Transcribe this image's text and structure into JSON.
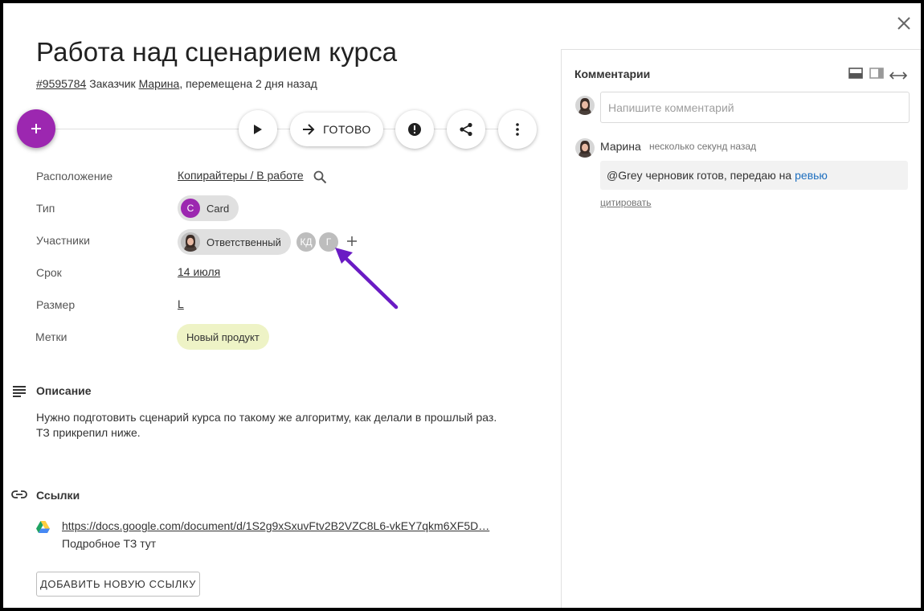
{
  "task": {
    "title": "Работа над сценарием курса",
    "id": "#9595784",
    "customer_prefix": "Заказчик",
    "customer": "Марина",
    "moved": ", перемещена 2 дня назад"
  },
  "toolbar": {
    "add_label": "+",
    "done_label": "ГОТОВО"
  },
  "properties": {
    "location": {
      "label": "Расположение",
      "value": "Копирайтеры / В работе"
    },
    "type": {
      "label": "Тип",
      "avatar_letter": "C",
      "value": "Card"
    },
    "members": {
      "label": "Участники",
      "responsible": "Ответственный",
      "member1": "КД",
      "member2": "Г"
    },
    "deadline": {
      "label": "Срок",
      "value": "14 июля"
    },
    "size": {
      "label": "Размер",
      "value": "L"
    },
    "tags": {
      "label": "Метки",
      "value": "Новый продукт"
    }
  },
  "description": {
    "title": "Описание",
    "line1": "Нужно подготовить сценарий курса по такому же алгоритму, как делали в прошлый раз.",
    "line2": "ТЗ прикрепил ниже."
  },
  "links": {
    "title": "Ссылки",
    "url": "https://docs.google.com/document/d/1S2g9xSxuvFtv2B2VZC8L6-vkEY7qkm6XF5D…",
    "caption": "Подробное ТЗ тут",
    "add_button": "ДОБАВИТЬ НОВУЮ ССЫЛКУ"
  },
  "comments": {
    "title": "Комментарии",
    "input_placeholder": "Напишите комментарий",
    "items": [
      {
        "author": "Марина",
        "time": "несколько секунд назад",
        "text": "@Grey черновик готов, передаю на",
        "link_text": "ревью",
        "quote_label": "цитировать"
      }
    ]
  },
  "colors": {
    "accent": "#9c27b0",
    "tag_bg": "#eef3c6",
    "annotation_arrow": "#6a1bc4",
    "link": "#1e6fbf"
  },
  "icons": [
    "close-icon",
    "play-icon",
    "arrow-right-icon",
    "alert-icon",
    "share-icon",
    "more-vert-icon",
    "search-icon",
    "add-icon",
    "subject-icon",
    "link-icon",
    "google-drive-icon",
    "layout-bottom-icon",
    "layout-side-icon",
    "expand-horizontal-icon"
  ]
}
